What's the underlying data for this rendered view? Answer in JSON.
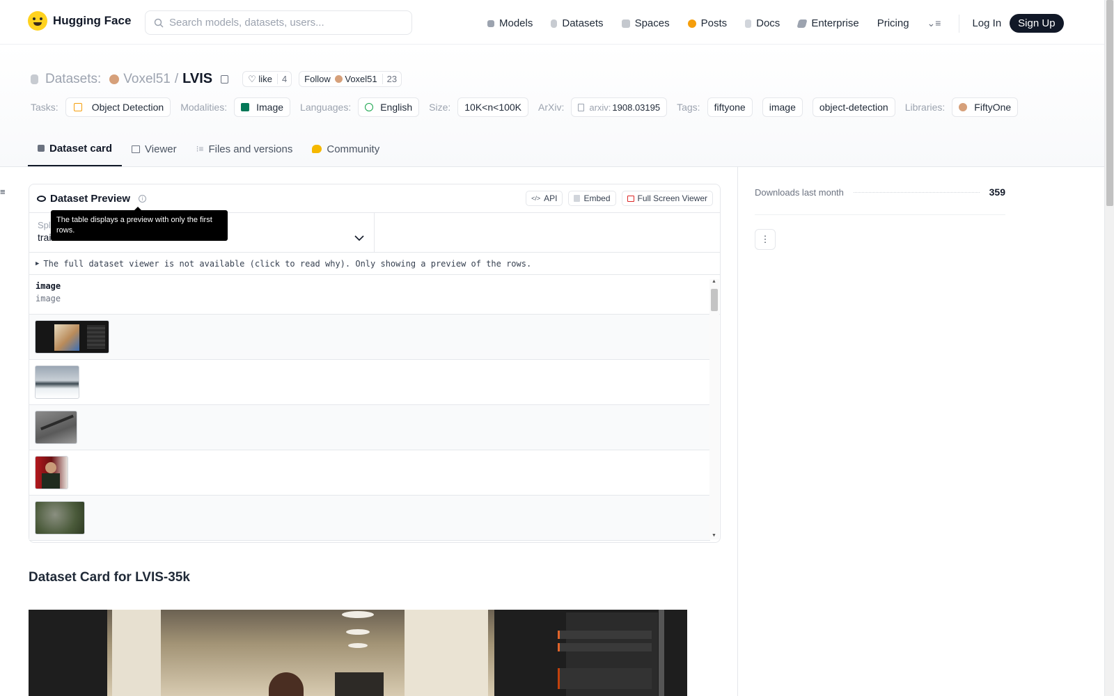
{
  "nav": {
    "brand": "Hugging Face",
    "search_placeholder": "Search models, datasets, users...",
    "links": [
      "Models",
      "Datasets",
      "Spaces",
      "Posts",
      "Docs",
      "Enterprise",
      "Pricing"
    ],
    "login": "Log In",
    "signup": "Sign Up"
  },
  "header": {
    "section": "Datasets:",
    "owner": "Voxel51",
    "separator": "/",
    "name": "LVIS",
    "like_label": "like",
    "like_count": "4",
    "follow_label": "Follow",
    "follow_target": "Voxel51",
    "follow_count": "23",
    "tags": {
      "tasks_label": "Tasks:",
      "task": "Object Detection",
      "modalities_label": "Modalities:",
      "modality": "Image",
      "languages_label": "Languages:",
      "language": "English",
      "size_label": "Size:",
      "size": "10K<n<100K",
      "arxiv_label": "ArXiv:",
      "arxiv_prefix": "arxiv:",
      "arxiv_id": "1908.03195",
      "tags_label": "Tags:",
      "tag_list": [
        "fiftyone",
        "image",
        "object-detection"
      ],
      "libraries_label": "Libraries:",
      "library": "FiftyOne"
    },
    "tabs": [
      "Dataset card",
      "Viewer",
      "Files and versions",
      "Community"
    ]
  },
  "preview": {
    "title": "Dataset Preview",
    "api": "API",
    "embed": "Embed",
    "fullscreen": "Full Screen Viewer",
    "tooltip": "The table displays a preview with only the first rows.",
    "split_label": "Split",
    "split_value": "train",
    "notice": "The full dataset viewer is not available (click to read why). Only showing a preview of the rows.",
    "column_name": "image",
    "column_type": "image"
  },
  "card": {
    "heading": "Dataset Card for LVIS-35k"
  },
  "sidebar": {
    "downloads_label": "Downloads last month",
    "downloads_value": "359"
  },
  "colors": {
    "accent_dark": "#111827",
    "border": "#e5e7eb",
    "muted": "#9ca3af",
    "brand_yellow": "#ffd21e"
  }
}
